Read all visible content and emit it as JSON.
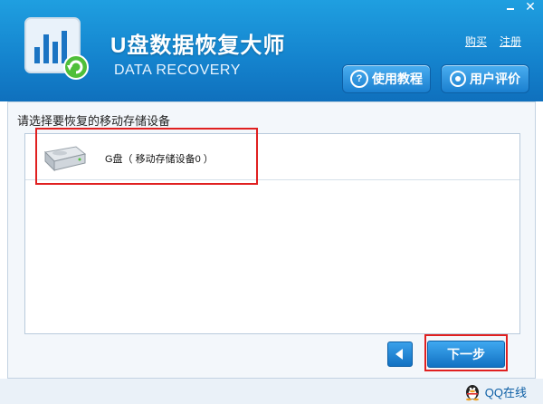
{
  "app": {
    "title": "U盘数据恢复大师",
    "subtitle": "DATA RECOVERY"
  },
  "window_controls": {
    "minimize": "minimize-icon",
    "close": "close-icon"
  },
  "header_links": {
    "buy": "购买",
    "register": "注册"
  },
  "header_buttons": {
    "tutorial": "使用教程",
    "review": "用户评价",
    "tutorial_icon": "?"
  },
  "device_section": {
    "label": "请选择要恢复的移动存储设备",
    "devices": [
      {
        "name": "G盘（ 移动存储设备0 ）",
        "icon": "drive-icon"
      }
    ]
  },
  "nav": {
    "back_icon": "back-arrow-icon",
    "next": "下一步"
  },
  "footer": {
    "qq": "QQ在线"
  },
  "colors": {
    "header_blue": "#1585cf",
    "highlight_red": "#e02020",
    "button_blue": "#1a7fcf"
  }
}
